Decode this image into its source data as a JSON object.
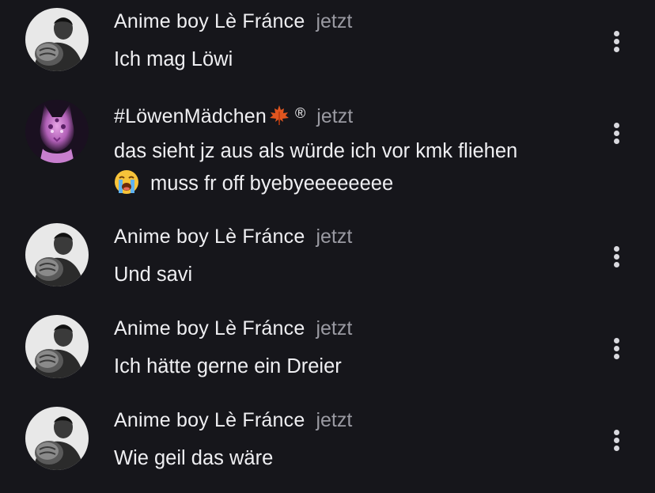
{
  "comments": [
    {
      "user": "Anime boy Lè Fránce",
      "time": "jetzt",
      "text": "Ich mag Löwi",
      "avatar": "boxer-avatar"
    },
    {
      "user": "#LöwenMädchen",
      "badges": [
        "maple-leaf-emoji",
        "®"
      ],
      "time": "jetzt",
      "text_line1": "das sieht jz aus als würde ich vor kmk fliehen",
      "text_line2": "muss fr off byebyeeeeeeee",
      "emoji": "loudly-crying-face-emoji",
      "avatar": "pink-cat-avatar"
    },
    {
      "user": "Anime boy Lè Fránce",
      "time": "jetzt",
      "text": "Und savi",
      "avatar": "boxer-avatar"
    },
    {
      "user": "Anime boy Lè Fránce",
      "time": "jetzt",
      "text": "Ich hätte gerne ein Dreier",
      "avatar": "boxer-avatar"
    },
    {
      "user": "Anime boy Lè Fránce",
      "time": "jetzt",
      "text": "Wie geil das wäre",
      "avatar": "boxer-avatar"
    }
  ],
  "colors": {
    "background": "#16161b",
    "text": "#efeff2",
    "timestamp": "#9a9aa2",
    "menu_dots": "#d9d9de"
  }
}
